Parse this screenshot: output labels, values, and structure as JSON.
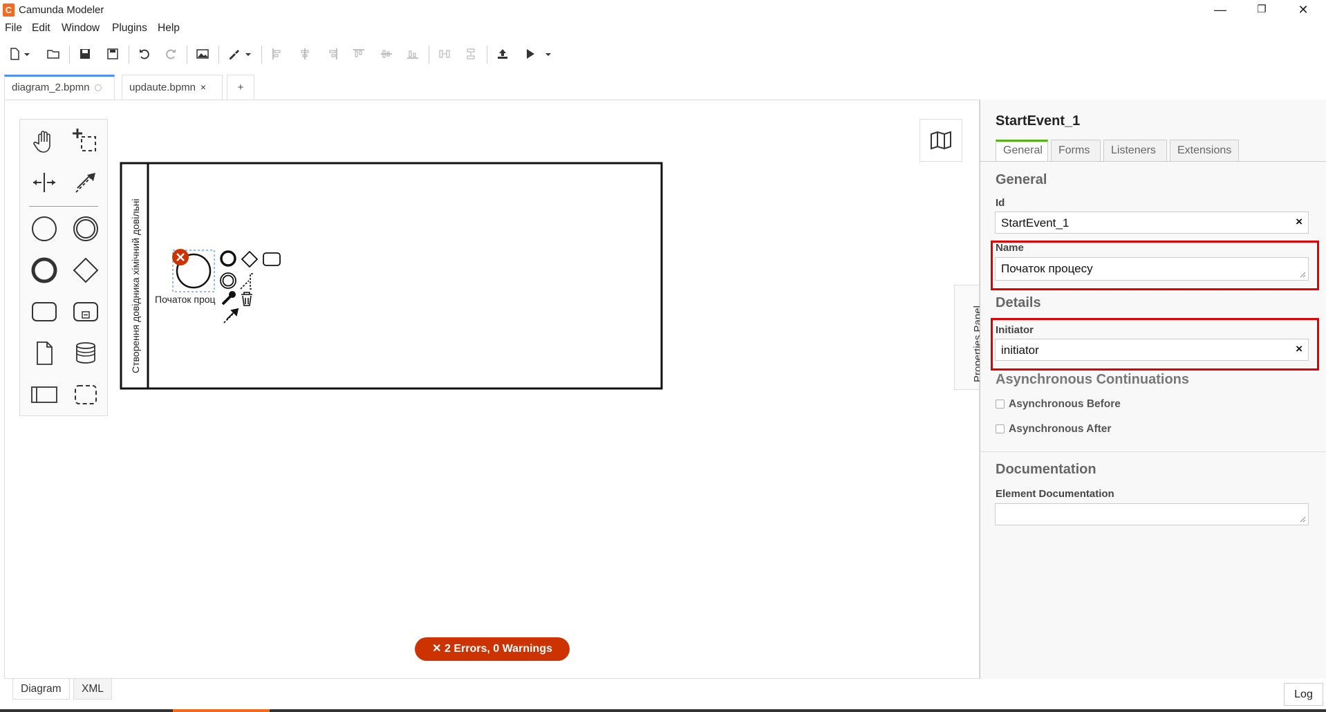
{
  "window": {
    "title": "Camunda Modeler",
    "logo_letter": "C",
    "minimize": "—",
    "restore": "❐",
    "close": "✕"
  },
  "menu": [
    "File",
    "Edit",
    "Window",
    "Plugins",
    "Help"
  ],
  "tabs": [
    {
      "label": "diagram_2.bpmn",
      "active": true
    },
    {
      "label": "updaute.bpmn",
      "close": "×"
    }
  ],
  "tab_add": "+",
  "canvas": {
    "lane_label": "Створення довідника хімічний довільні",
    "event_label": "Початок проц",
    "error_badge": "✕  2 Errors, 0 Warnings"
  },
  "properties_toggle": "Properties Panel",
  "properties": {
    "title": "StartEvent_1",
    "tabs": [
      "General",
      "Forms",
      "Listeners",
      "Extensions"
    ],
    "active_tab": "General",
    "general_header": "General",
    "id_label": "Id",
    "id_value": "StartEvent_1",
    "name_label": "Name",
    "name_value": "Початок процесу",
    "details_header": "Details",
    "initiator_label": "Initiator",
    "initiator_value": "initiator",
    "clear_symbol": "×",
    "async_header": "Asynchronous Continuations",
    "async_before": "Asynchronous Before",
    "async_after": "Asynchronous After",
    "doc_header": "Documentation",
    "doc_label": "Element Documentation",
    "doc_value": ""
  },
  "bottom_tabs": [
    "Diagram",
    "XML"
  ],
  "log_button": "Log",
  "colors": {
    "accent_tab": "#4d90fe",
    "props_active_tab": "#52b415",
    "error": "#cc3300",
    "highlight": "#e00000",
    "brand": "#f26b21"
  }
}
